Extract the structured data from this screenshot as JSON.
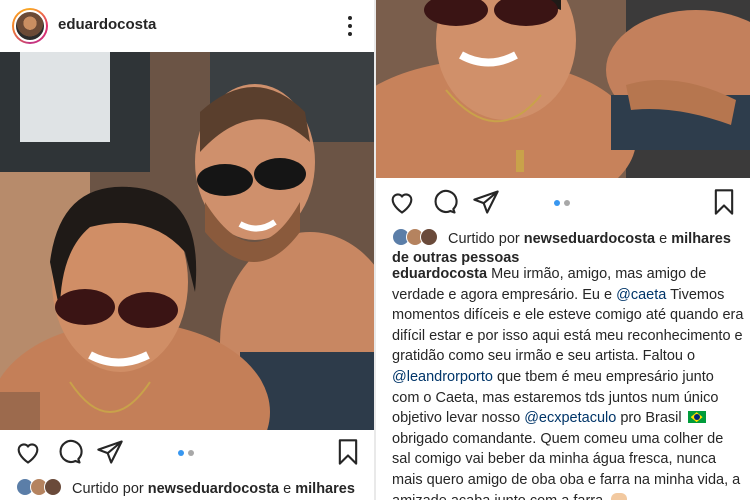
{
  "left": {
    "username": "eduardocosta",
    "likes": {
      "prefix": "Curtido por",
      "user": "newseduardocosta",
      "and": "e",
      "others": "milhares"
    }
  },
  "right": {
    "likes": {
      "prefix": "Curtido por",
      "user": "newseduardocosta",
      "and": "e",
      "others": "milhares de outras pessoas"
    },
    "caption": {
      "author": "eduardocosta",
      "t1": "Meu irmão, amigo, mas amigo de verdade e agora empresário. Eu e",
      "m1": "@caeta",
      "t2": "Tivemos momentos difíceis e ele esteve comigo até quando era difícil estar e por isso aqui está meu reconhecimento e gratidão como seu irmão e seu artista. Faltou o",
      "m2": "@leandrorporto",
      "t3": "que tbem é meu empresário junto com o Caeta, mas estaremos tds juntos num único objetivo levar nosso",
      "m3": "@ecxpetaculo",
      "t4": "pro Brasil",
      "t5": "obrigado comandante. Quem comeu uma colher de sal comigo vai beber da minha água fresca, nunca mais quero amigo de oba oba e farra na minha vida, a amizade acaba junto com a farra."
    }
  },
  "icons": [
    "heart-icon",
    "comment-icon",
    "share-icon",
    "bookmark-icon",
    "more-icon",
    "brazil-flag-icon"
  ],
  "colors": {
    "accent": "#3897f0",
    "mention": "#003569",
    "text": "#262626"
  }
}
